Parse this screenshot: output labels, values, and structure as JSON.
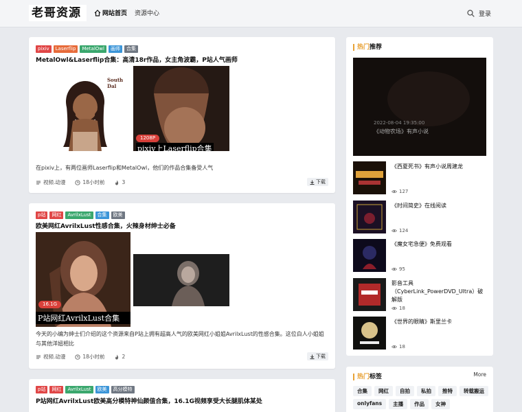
{
  "header": {
    "logo": "老哥资源",
    "nav_home": "网站首页",
    "nav_resources": "资源中心",
    "login": "登录"
  },
  "posts": [
    {
      "tags": [
        "pixiv",
        "Laserflip",
        "MetalOwl",
        "画师",
        "合集"
      ],
      "tag_colors": [
        "#e04646",
        "#e76b3a",
        "#3aa76d",
        "#3b95d8",
        "#6f7782"
      ],
      "title": "MetalOwl&Laserflip合集：高清18r作品，女主角波霸，P站人气画师",
      "image_size": "1208P",
      "image_caption": "pixiv上Laserflip合集",
      "image_label": "South Dal",
      "excerpt": "在pixiv上，有两位画师Laserflip和MetalOwl，他们的作品合集备受人气",
      "category": "视频.动漫",
      "time": "18小时前",
      "likes": "3",
      "download": "下载"
    },
    {
      "tags": [
        "p站",
        "网红",
        "AvrilxLust",
        "合集",
        "欧美"
      ],
      "title": "欧美网红AvrilxLust性感合集，火辣身材绅士必备",
      "image_size": "16.1G",
      "image_caption": "P站网红AvrilxLust合集",
      "excerpt": "今天的小编为绅士们介绍的这个资源来自P站上拥有超高人气的欧美网红小姐姐AvrilxLust的性感合集。这位白人小姐姐与其他洋妞相比",
      "category": "视频.动漫",
      "time": "18小时前",
      "likes": "2",
      "download": "下载"
    },
    {
      "tags": [
        "p站",
        "网红",
        "AvrilxLust",
        "欧美",
        "高分模特"
      ],
      "title": "P站网红AvrilxLust欧美高分模特神仙颜值合集，16.1G视频享受大长腿肌体某处"
    }
  ],
  "sidebar": {
    "hot_title_hot": "热门",
    "hot_title_rest": "推荐",
    "feature": {
      "date": "2022-08-04 19:35:00",
      "title": "《动物农场》有声小说"
    },
    "hot_items": [
      {
        "title": "《西夏死书》有声小说周建龙",
        "views": "127"
      },
      {
        "title": "《时间简史》在线阅读",
        "views": "124"
      },
      {
        "title": "《魔女宅急便》免费观看",
        "views": "95"
      },
      {
        "title": "影音工具（CyberLink_PowerDVD_Ultra）破解版",
        "views": "18"
      },
      {
        "title": "《世界的眼睛》斯里兰卡",
        "views": "18"
      }
    ],
    "tags_title_hot": "热门",
    "tags_title_rest": "标签",
    "more": "More",
    "tag_cloud": [
      "合集",
      "网红",
      "自拍",
      "私拍",
      "推特",
      "转载搬运",
      "onlyfans",
      "主播",
      "作品",
      "女神"
    ]
  },
  "colors": {
    "accent": "#e8a135",
    "tag_red": "#e04646",
    "background": "#e8eaee"
  }
}
